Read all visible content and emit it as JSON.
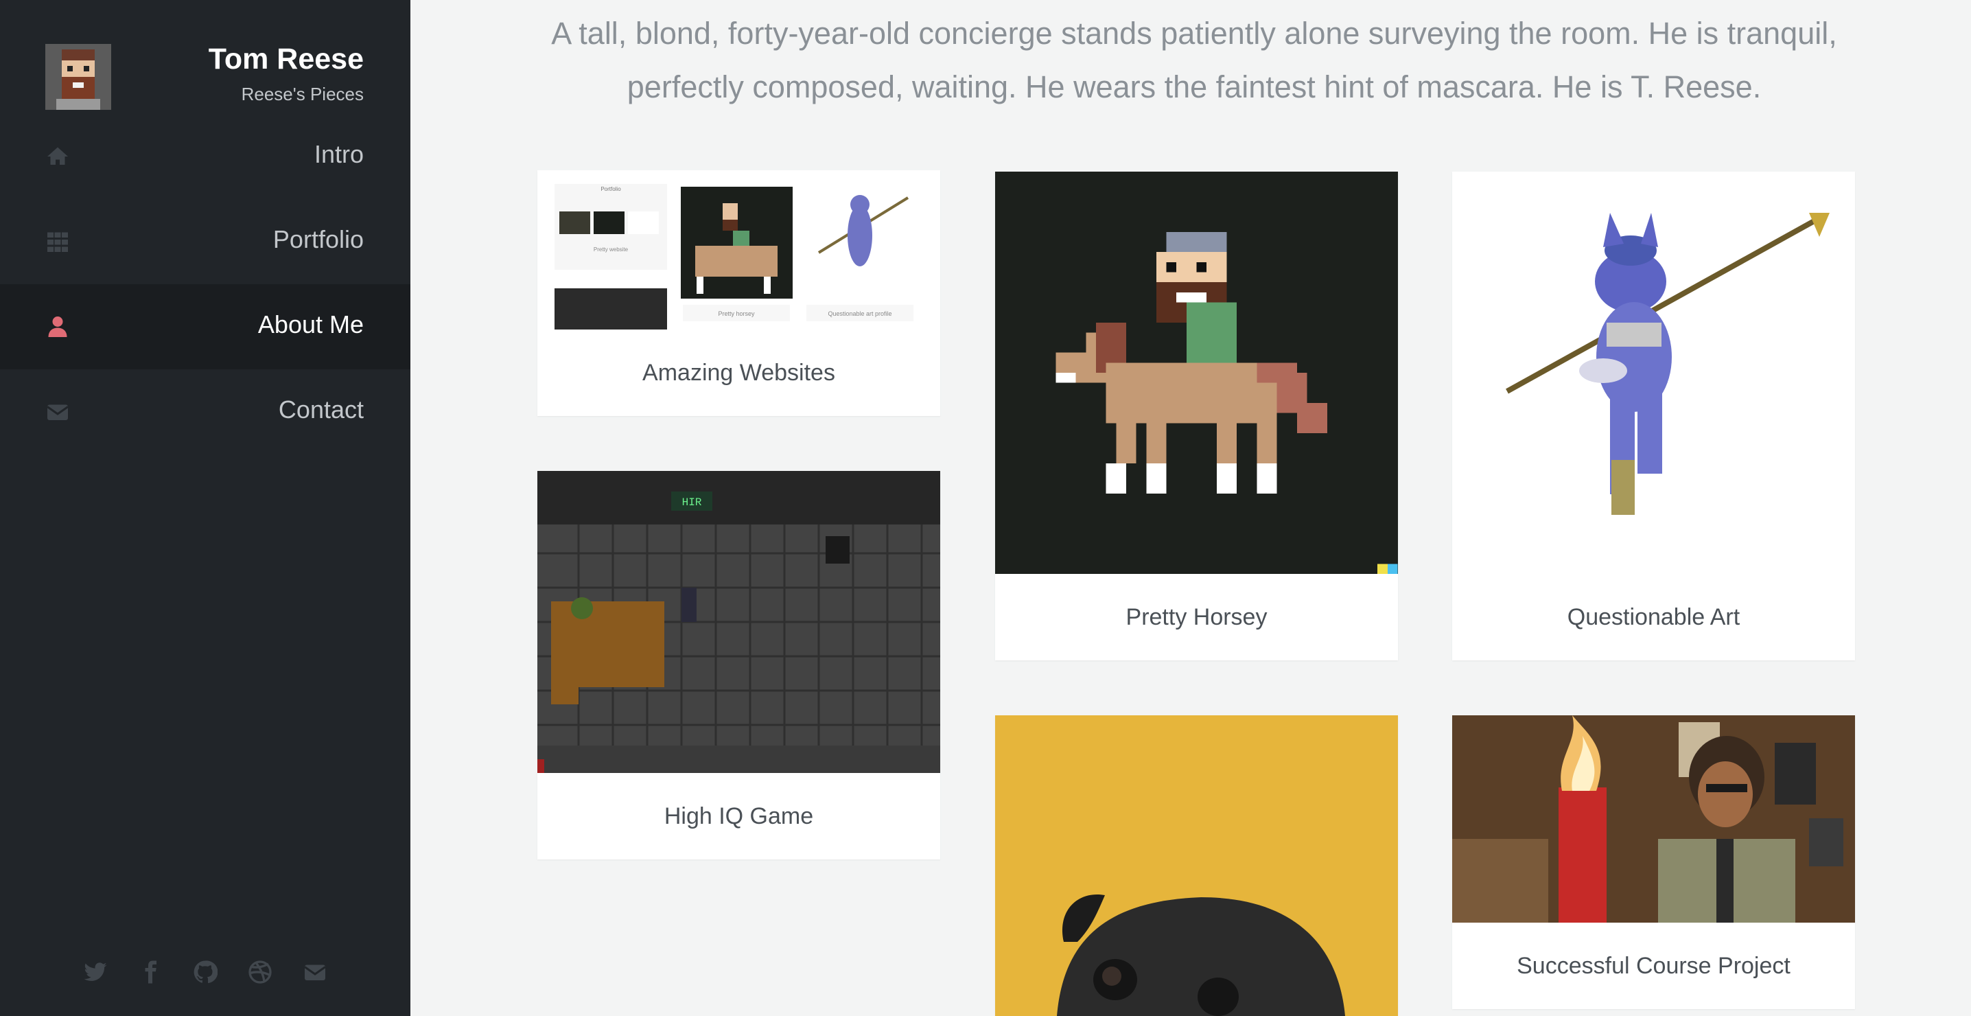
{
  "profile": {
    "name": "Tom Reese",
    "tagline": "Reese's Pieces"
  },
  "nav": [
    {
      "label": "Intro",
      "icon": "home-icon",
      "active": false
    },
    {
      "label": "Portfolio",
      "icon": "grid-icon",
      "active": false
    },
    {
      "label": "About Me",
      "icon": "user-icon",
      "active": true
    },
    {
      "label": "Contact",
      "icon": "envelope-icon",
      "active": false
    }
  ],
  "social": [
    "twitter-icon",
    "facebook-icon",
    "github-icon",
    "dribbble-icon",
    "envelope-icon"
  ],
  "intro_text": "A tall, blond, forty-year-old concierge stands patiently alone surveying the room. He is tranquil, perfectly composed, waiting. He wears the faintest hint of mascara. He is T. Reese.",
  "portfolio": {
    "cards": [
      {
        "caption": "Amazing Websites"
      },
      {
        "caption": "High IQ Game"
      },
      {
        "caption": "Pretty Horsey"
      },
      {
        "caption": "Questionable Art"
      },
      {
        "caption": "Successful Course Project"
      }
    ],
    "mini_site": {
      "title": "Portfolio",
      "labels": [
        "Pretty website",
        "Pretty horsey",
        "Questionable art profile"
      ]
    },
    "game_sign": "HIR"
  },
  "colors": {
    "sidebar_bg": "#212529",
    "accent": "#e06b75",
    "pug_bg": "#e6b53b"
  }
}
